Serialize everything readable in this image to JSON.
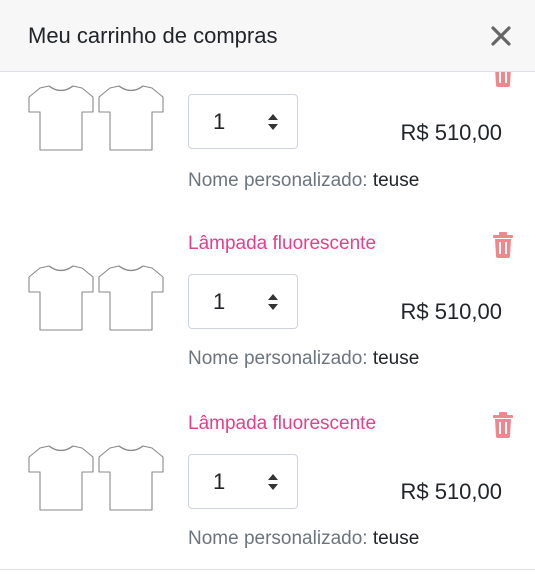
{
  "header": {
    "title": "Meu carrinho de compras",
    "close_icon": "close-icon"
  },
  "cart": {
    "items": [
      {
        "name": "",
        "quantity": "1",
        "price": "R$ 510,00",
        "custom_label": "Nome personalizado:",
        "custom_value": "teuse"
      },
      {
        "name": "Lâmpada fluorescente",
        "quantity": "1",
        "price": "R$ 510,00",
        "custom_label": "Nome personalizado:",
        "custom_value": "teuse"
      },
      {
        "name": "Lâmpada fluorescente",
        "quantity": "1",
        "price": "R$ 510,00",
        "custom_label": "Nome personalizado:",
        "custom_value": "teuse"
      }
    ]
  },
  "icons": {
    "product_image": "tshirt-icon",
    "delete": "trash-icon",
    "spinner": "spinner-arrows-icon"
  },
  "colors": {
    "header_bg": "#f7f7f7",
    "accent": "#e83e8c",
    "trash": "#f1868c",
    "muted_text": "#6c757d",
    "text": "#212529",
    "border": "#ced4da"
  }
}
